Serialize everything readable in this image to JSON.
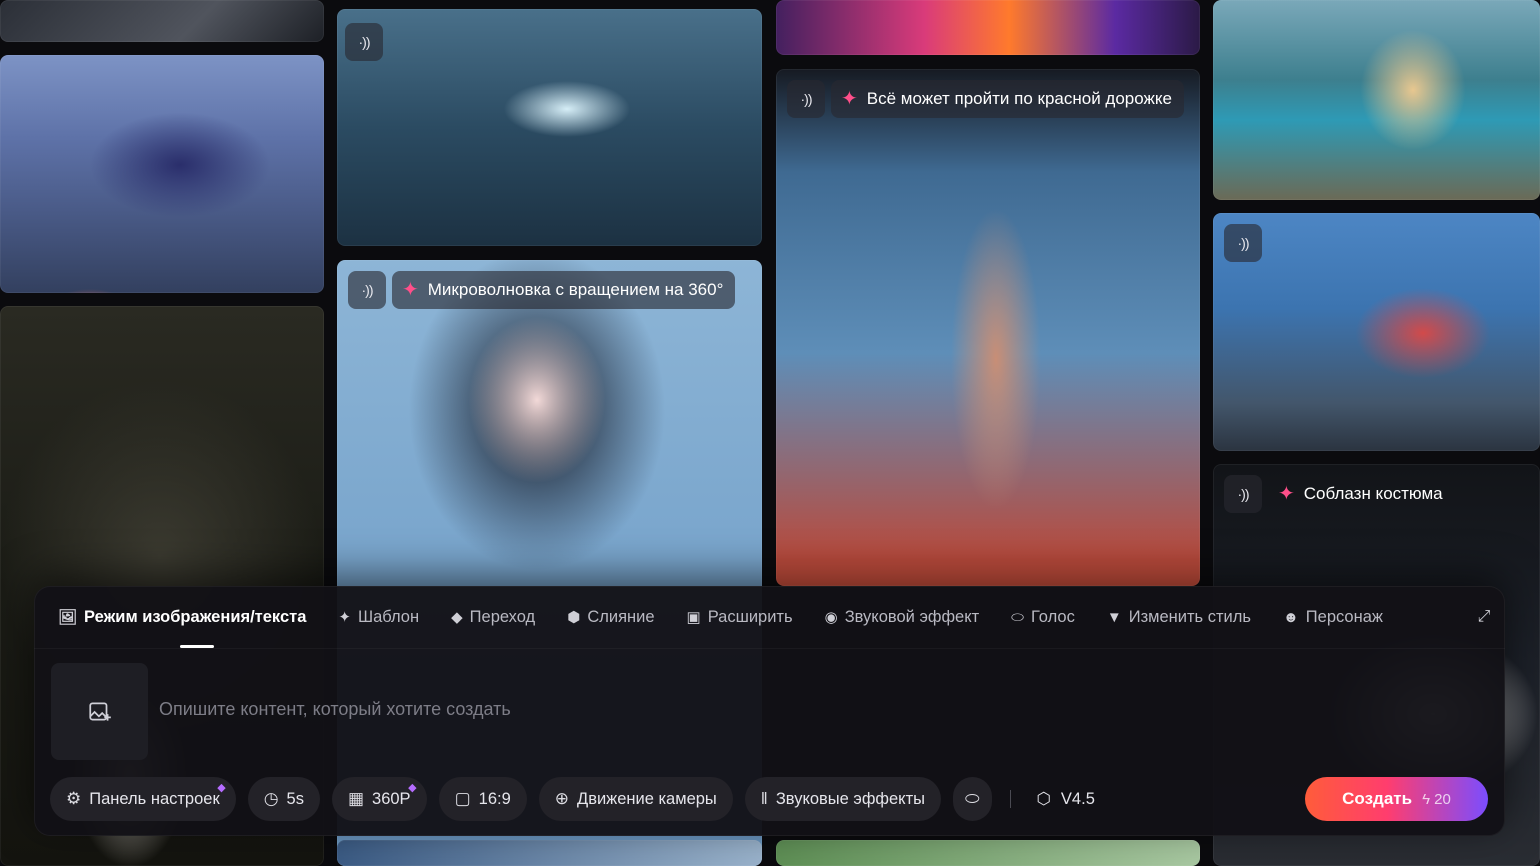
{
  "gallery": {
    "card_b2_title": "Микроволновка с вращением на 360°",
    "card_c2_title": "Всё может пройти по красной дорожке",
    "card_d3_title": "Соблазн костюма",
    "sound_symbol": "·))"
  },
  "tabs": [
    {
      "label": "Режим изображения/текста",
      "icon": "image-icon",
      "active": true
    },
    {
      "label": "Шаблон",
      "icon": "sparkle-icon"
    },
    {
      "label": "Переход",
      "icon": "transition-icon"
    },
    {
      "label": "Слияние",
      "icon": "cube-icon"
    },
    {
      "label": "Расширить",
      "icon": "expand-box-icon"
    },
    {
      "label": "Звуковой эффект",
      "icon": "sound-effect-icon"
    },
    {
      "label": "Голос",
      "icon": "lips-icon"
    },
    {
      "label": "Изменить стиль",
      "icon": "paint-roller-icon"
    },
    {
      "label": "Персонаж",
      "icon": "face-icon"
    }
  ],
  "prompt": {
    "placeholder": "Опишите контент, который хотите создать"
  },
  "options": {
    "settings": "Панель настроек",
    "duration": "5s",
    "resolution": "360P",
    "aspect": "16:9",
    "camera": "Движение камеры",
    "sfx": "Звуковые эффекты",
    "version": "V4.5"
  },
  "create": {
    "label": "Создать",
    "cost": "20"
  },
  "colors": {
    "accent_start": "#ff5c3a",
    "accent_end": "#7b4dff",
    "spark": "#ff4f8a",
    "premium_gem": "#b56cff"
  }
}
